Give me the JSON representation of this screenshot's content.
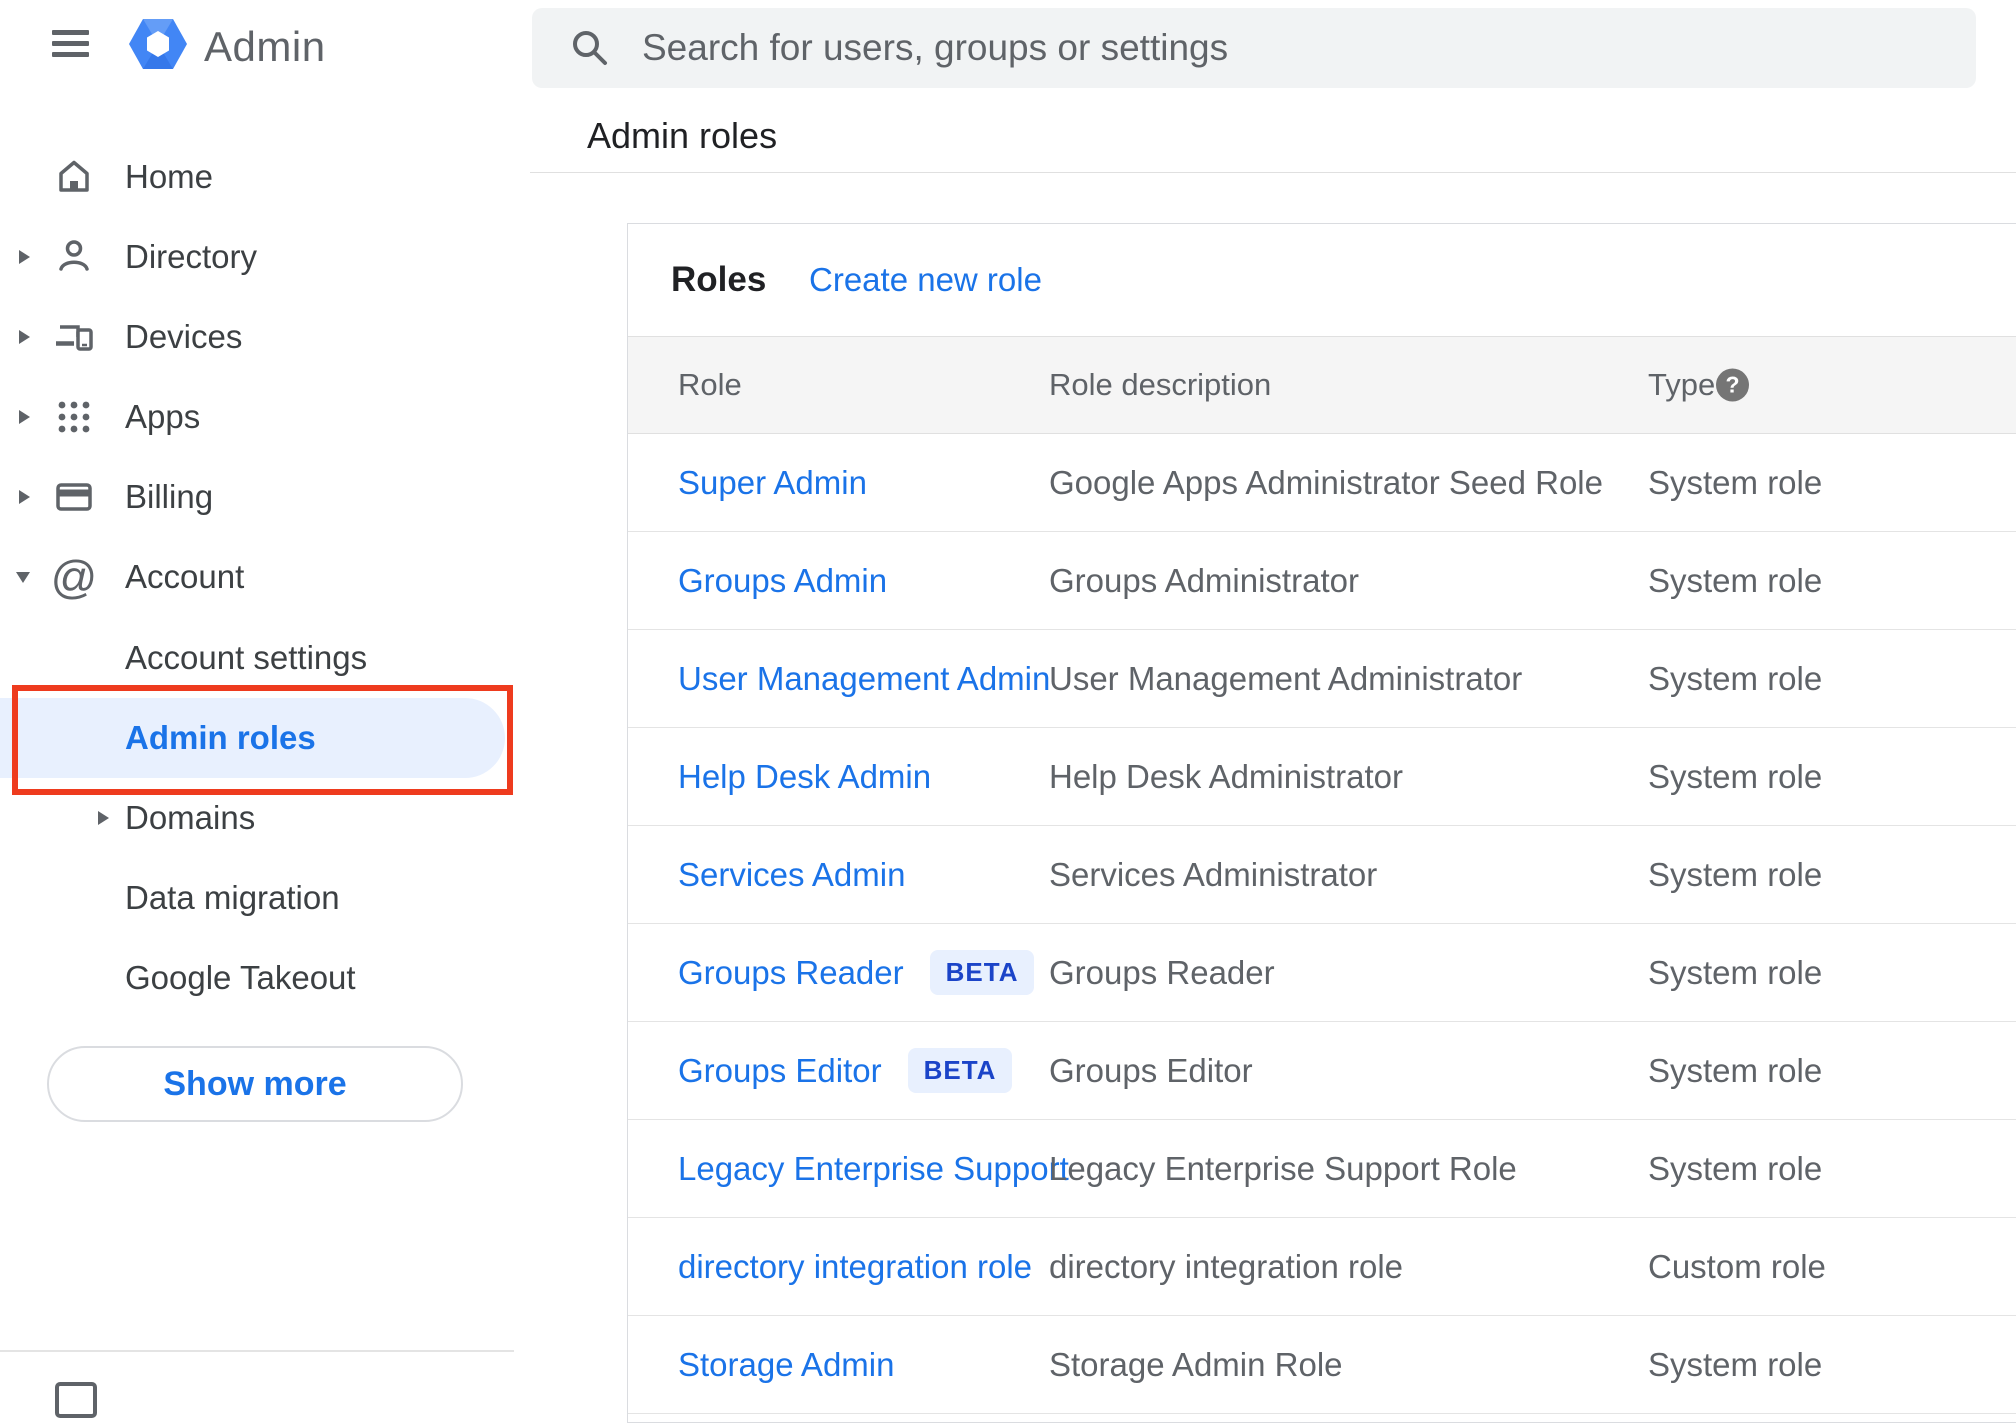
{
  "topbar": {
    "search_placeholder": "Search for users, groups or settings"
  },
  "breadcrumb": "Admin roles",
  "sidebar": {
    "logo_text": "Admin",
    "items": [
      {
        "label": "Home",
        "icon": "home-icon",
        "expandable": false,
        "expanded": false
      },
      {
        "label": "Directory",
        "icon": "person-icon",
        "expandable": true,
        "expanded": false
      },
      {
        "label": "Devices",
        "icon": "devices-icon",
        "expandable": true,
        "expanded": false
      },
      {
        "label": "Apps",
        "icon": "apps-grid-icon",
        "expandable": true,
        "expanded": false
      },
      {
        "label": "Billing",
        "icon": "billing-icon",
        "expandable": true,
        "expanded": false
      },
      {
        "label": "Account",
        "icon": "at-icon",
        "expandable": true,
        "expanded": true
      }
    ],
    "account_subitems": [
      {
        "label": "Account settings",
        "active": false,
        "expandable": false
      },
      {
        "label": "Admin roles",
        "active": true,
        "expandable": false
      },
      {
        "label": "Domains",
        "active": false,
        "expandable": true
      },
      {
        "label": "Data migration",
        "active": false,
        "expandable": false
      },
      {
        "label": "Google Takeout",
        "active": false,
        "expandable": false
      }
    ],
    "show_more_label": "Show more"
  },
  "roles_card": {
    "title": "Roles",
    "create_link": "Create new role",
    "columns": {
      "role": "Role",
      "description": "Role description",
      "type": "Type"
    },
    "beta_label": "BETA",
    "rows": [
      {
        "role": "Super Admin",
        "beta": false,
        "description": "Google Apps Administrator Seed Role",
        "type": "System role"
      },
      {
        "role": "Groups Admin",
        "beta": false,
        "description": "Groups Administrator",
        "type": "System role"
      },
      {
        "role": "User Management Admin",
        "beta": false,
        "description": "User Management Administrator",
        "type": "System role"
      },
      {
        "role": "Help Desk Admin",
        "beta": false,
        "description": "Help Desk Administrator",
        "type": "System role"
      },
      {
        "role": "Services Admin",
        "beta": false,
        "description": "Services Administrator",
        "type": "System role"
      },
      {
        "role": "Groups Reader",
        "beta": true,
        "description": "Groups Reader",
        "type": "System role"
      },
      {
        "role": "Groups Editor",
        "beta": true,
        "description": "Groups Editor",
        "type": "System role"
      },
      {
        "role": "Legacy Enterprise Support",
        "beta": false,
        "description": "Legacy Enterprise Support Role",
        "type": "System role"
      },
      {
        "role": "directory integration role",
        "beta": false,
        "description": "directory integration role",
        "type": "Custom role"
      },
      {
        "role": "Storage Admin",
        "beta": false,
        "description": "Storage Admin Role",
        "type": "System role"
      }
    ]
  },
  "colors": {
    "link_blue": "#1a73e8",
    "active_item_bg": "#e8f0fe",
    "beta_bg": "#e8f0fe",
    "beta_text": "#1b44c8",
    "annotation_red": "#ee3b1e",
    "search_bg": "#f1f3f4",
    "table_header_bg": "#f5f5f5",
    "text_gray": "#5f6368",
    "logo_blue": "#4286f5"
  }
}
